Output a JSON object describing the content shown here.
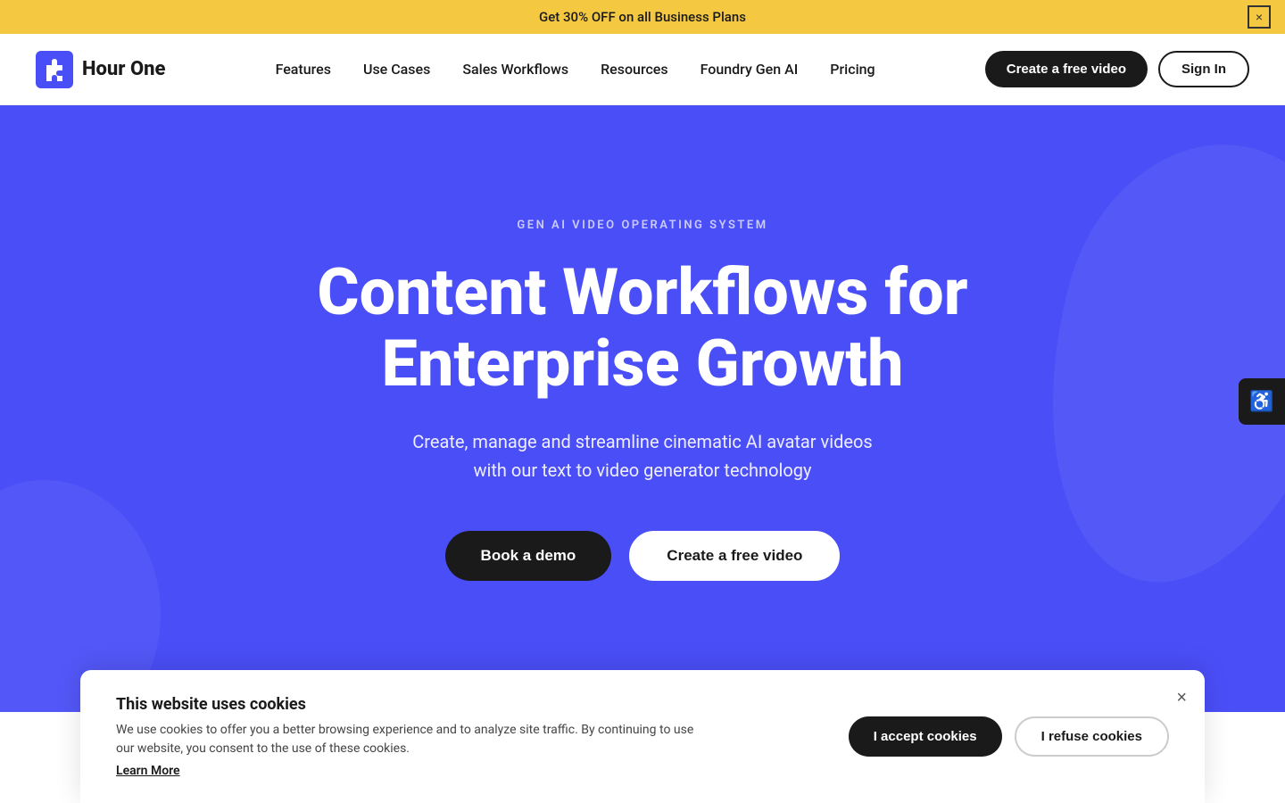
{
  "announcement": {
    "text": "Get 30% OFF on all Business Plans",
    "close_label": "×"
  },
  "navbar": {
    "logo_name": "Hour One",
    "logo_line1": "Hour",
    "logo_line2": "One",
    "nav_items": [
      {
        "label": "Features",
        "id": "features"
      },
      {
        "label": "Use Cases",
        "id": "use-cases"
      },
      {
        "label": "Sales Workflows",
        "id": "sales-workflows"
      },
      {
        "label": "Resources",
        "id": "resources"
      },
      {
        "label": "Foundry Gen AI",
        "id": "foundry-gen-ai"
      },
      {
        "label": "Pricing",
        "id": "pricing"
      }
    ],
    "cta_primary": "Create a free video",
    "cta_secondary": "Sign In"
  },
  "hero": {
    "tag": "GEN AI VIDEO OPERATING SYSTEM",
    "title_line1": "Content Workflows for",
    "title_line2": "Enterprise Growth",
    "subtitle_line1": "Create, manage and streamline cinematic AI avatar videos",
    "subtitle_line2": "with our text to video generator technology",
    "btn_demo": "Book a demo",
    "btn_create": "Create a free video"
  },
  "accessibility": {
    "icon": "♿",
    "label": "Accessibility"
  },
  "cookie": {
    "title": "This website uses cookies",
    "description": "We use cookies to offer you a better browsing experience and to analyze site traffic. By continuing to use our website, you consent to the use of these cookies.",
    "learn_more": "Learn More",
    "accept_label": "I accept cookies",
    "refuse_label": "I refuse cookies",
    "close_label": "×"
  }
}
